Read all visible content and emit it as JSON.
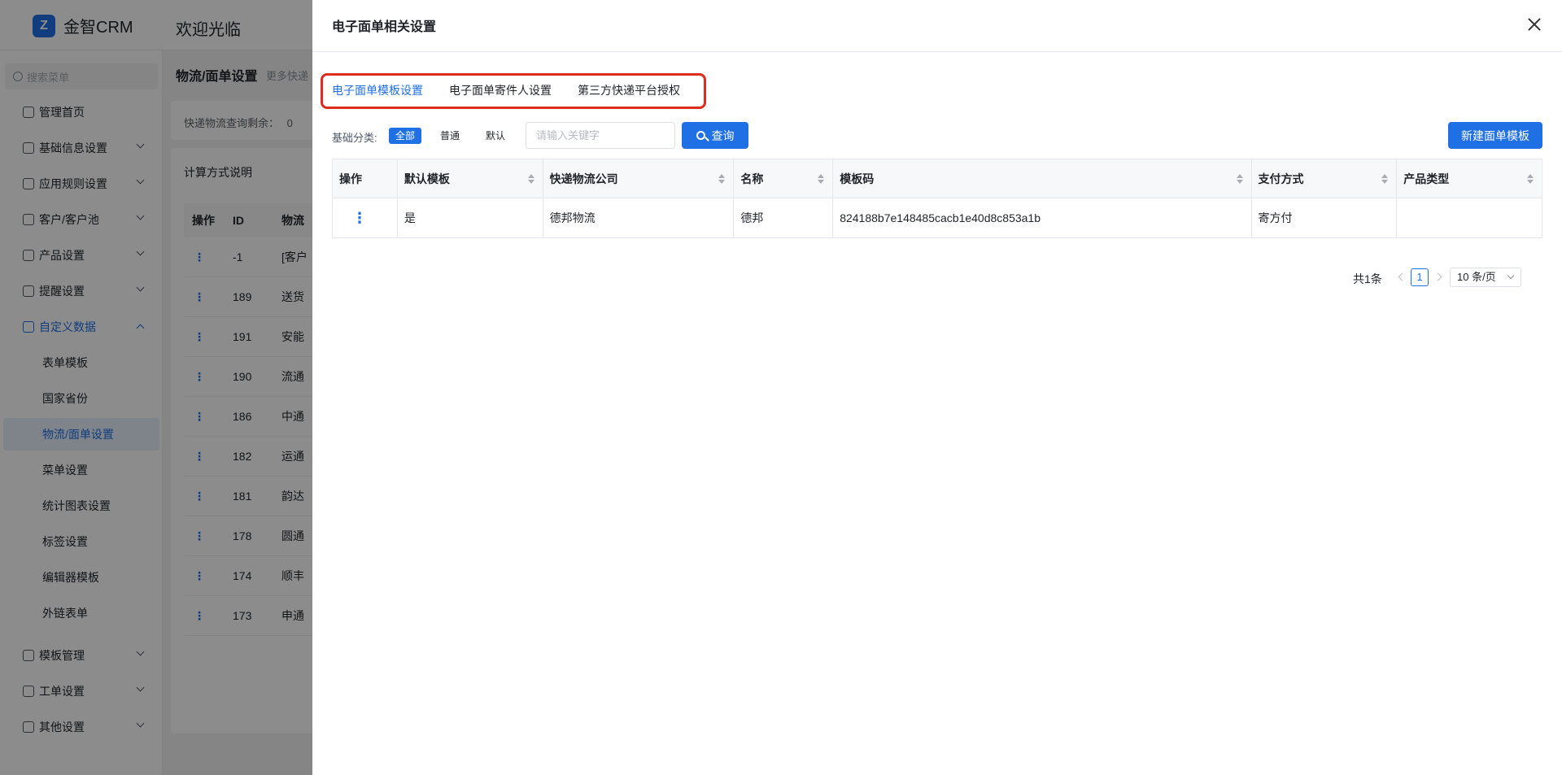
{
  "app": {
    "logo_mark": "Z",
    "name": "金智CRM",
    "welcome": "欢迎光临"
  },
  "sidebar": {
    "search_placeholder": "搜索菜单",
    "items": [
      {
        "label": "管理首页",
        "icon": "home-icon"
      },
      {
        "label": "基础信息设置",
        "icon": "cube-icon"
      },
      {
        "label": "应用规则设置",
        "icon": "document-icon"
      },
      {
        "label": "客户/客户池",
        "icon": "user-icon"
      },
      {
        "label": "产品设置",
        "icon": "box-icon"
      },
      {
        "label": "提醒设置",
        "icon": "bell-icon"
      },
      {
        "label": "自定义数据",
        "icon": "tools-icon"
      }
    ],
    "subitems": [
      "表单模板",
      "国家省份",
      "物流/面单设置",
      "菜单设置",
      "统计图表设置",
      "标签设置",
      "编辑器模板",
      "外链表单"
    ],
    "bottom_items": [
      {
        "label": "模板管理",
        "icon": "template-icon"
      },
      {
        "label": "工单设置",
        "icon": "ticket-icon"
      },
      {
        "label": "其他设置",
        "icon": "grid-icon"
      }
    ]
  },
  "background_page": {
    "title": "物流/面单设置",
    "subtitle": "更多快递",
    "query_remaining": "快递物流查询剩余：",
    "query_remaining_value": "0",
    "calc_title": "计算方式说明",
    "table_headers": [
      "操作",
      "ID",
      "物流"
    ],
    "rows": [
      {
        "id": "-1",
        "name": "[客户"
      },
      {
        "id": "189",
        "name": "送货"
      },
      {
        "id": "191",
        "name": "安能"
      },
      {
        "id": "190",
        "name": "流通"
      },
      {
        "id": "186",
        "name": "中通"
      },
      {
        "id": "182",
        "name": "运通"
      },
      {
        "id": "181",
        "name": "韵达"
      },
      {
        "id": "178",
        "name": "圆通"
      },
      {
        "id": "174",
        "name": "顺丰"
      },
      {
        "id": "173",
        "name": "申通"
      }
    ]
  },
  "drawer": {
    "title": "电子面单相关设置",
    "tabs": [
      "电子面单模板设置",
      "电子面单寄件人设置",
      "第三方快递平台授权"
    ],
    "active_tab": 0,
    "filter": {
      "label": "基础分类:",
      "chips": [
        "全部",
        "普通",
        "默认"
      ],
      "active_chip": 0,
      "keyword_placeholder": "请输入关键字",
      "query_label": "查询",
      "new_label": "新建面单模板"
    },
    "table": {
      "headers": [
        "操作",
        "默认模板",
        "快递物流公司",
        "名称",
        "模板码",
        "支付方式",
        "产品类型"
      ],
      "rows": [
        {
          "action": "⋮",
          "default": "是",
          "company": "德邦物流",
          "name": "德邦",
          "code": "824188b7e148485cacb1e40d8c853a1b",
          "payment": "寄方付",
          "product_type": ""
        }
      ]
    },
    "pagination": {
      "total": "共1条",
      "current_page": "1",
      "page_size": "10 条/页"
    }
  },
  "colors": {
    "primary": "#1f6fe5",
    "highlight_border": "#e02b1d"
  }
}
